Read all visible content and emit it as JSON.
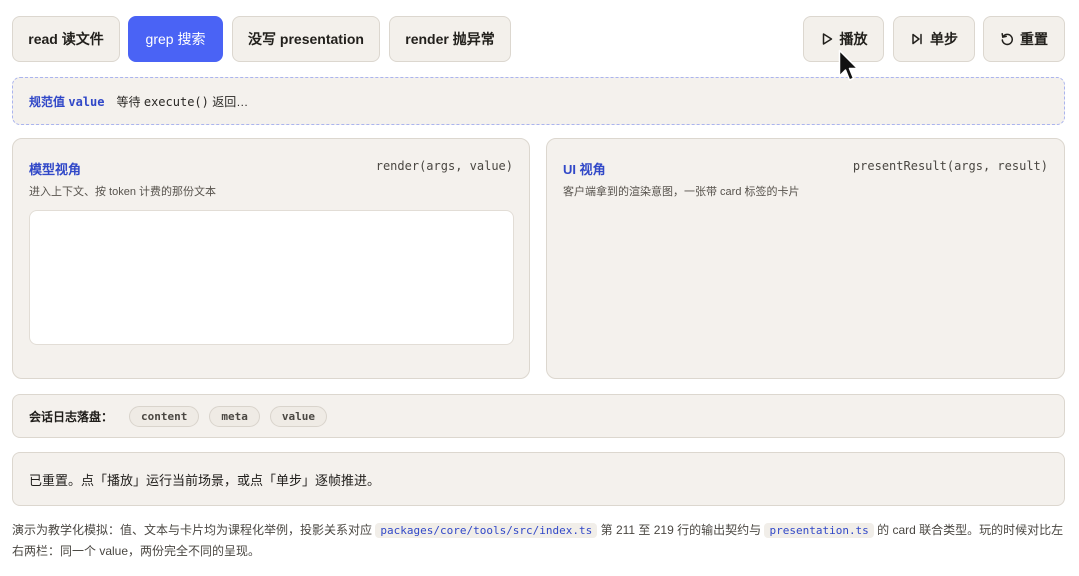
{
  "toolbar": {
    "scenarios": [
      {
        "label": "read 读文件",
        "active": false
      },
      {
        "label": "grep 搜索",
        "active": true
      },
      {
        "label": "没写 presentation",
        "active": false
      },
      {
        "label": "render 抛异常",
        "active": false
      }
    ],
    "play_label": "播放",
    "step_label": "单步",
    "reset_label": "重置",
    "icons": {
      "play": "play-icon",
      "step": "step-forward-icon",
      "reset": "reset-icon"
    }
  },
  "value_bar": {
    "tag_prefix": "规范值",
    "tag_code": "value",
    "wait_prefix": "等待",
    "wait_code": "execute()",
    "wait_suffix": "返回…"
  },
  "model_panel": {
    "title": "模型视角",
    "signature": "render(args, value)",
    "description": "进入上下文、按 token 计费的那份文本"
  },
  "ui_panel": {
    "title": "UI 视角",
    "signature": "presentResult(args, result)",
    "description": "客户端拿到的渲染意图，一张带 card 标签的卡片"
  },
  "session_log": {
    "label": "会话日志落盘：",
    "fields": [
      "content",
      "meta",
      "value"
    ]
  },
  "status": {
    "message": "已重置。点「播放」运行当前场景，或点「单步」逐帧推进。"
  },
  "footer": {
    "text1": "演示为教学化模拟：值、文本与卡片均为课程化举例，投影关系对应",
    "code1": "packages/core/tools/src/index.ts",
    "text2": "第 211 至 219 行的输出契约与",
    "code2": "presentation.ts",
    "text3": "的 card 联合类型。玩的时候对比左右两栏：同一个 value，两份完全不同的呈现。"
  },
  "colors": {
    "accent": "#4a63f5",
    "accent_text": "#3148c8",
    "panel_bg": "#f4f1ed",
    "border": "#dcd7cf"
  }
}
